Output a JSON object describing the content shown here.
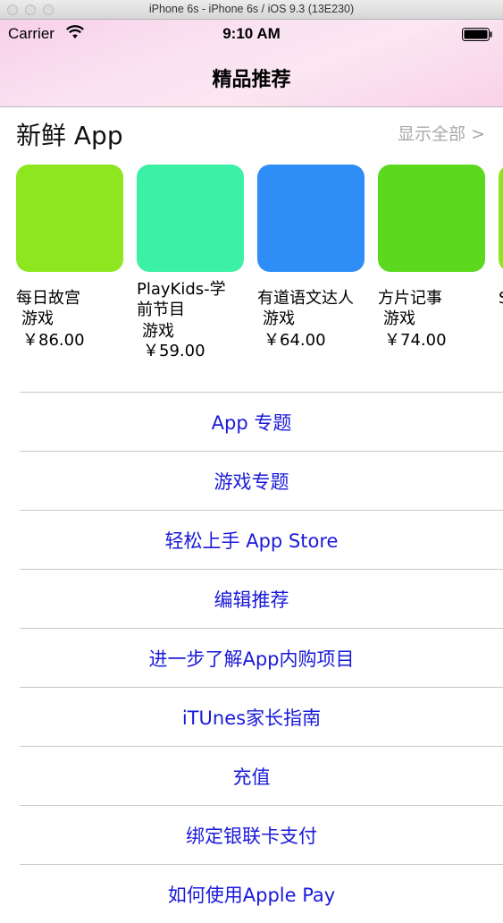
{
  "window": {
    "title": "iPhone 6s - iPhone 6s / iOS 9.3 (13E230)"
  },
  "status_bar": {
    "carrier": "Carrier",
    "time": "9:10 AM"
  },
  "nav": {
    "title": "精品推荐"
  },
  "fresh_apps": {
    "title": "新鲜 App",
    "show_all": "显示全部 >",
    "apps": [
      {
        "name": "每日故宫",
        "category": "游戏",
        "price": "￥86.00",
        "color": "#8de61f"
      },
      {
        "name": "PlayKids-学前节目",
        "category": "游戏",
        "price": "￥59.00",
        "color": "#3cf0a5"
      },
      {
        "name": "有道语文达人",
        "category": "游戏",
        "price": "￥64.00",
        "color": "#2f8df7"
      },
      {
        "name": "方片记事",
        "category": "游戏",
        "price": "￥74.00",
        "color": "#5cd81e"
      },
      {
        "name": "S",
        "category": "",
        "price": "",
        "color": "#8de61f"
      }
    ]
  },
  "links": [
    "App 专题",
    "游戏专题",
    "轻松上手 App Store",
    "编辑推荐",
    "进一步了解App内购项目",
    "iTUnes家长指南",
    "充值",
    "绑定银联卡支付",
    "如何使用Apple Pay"
  ]
}
